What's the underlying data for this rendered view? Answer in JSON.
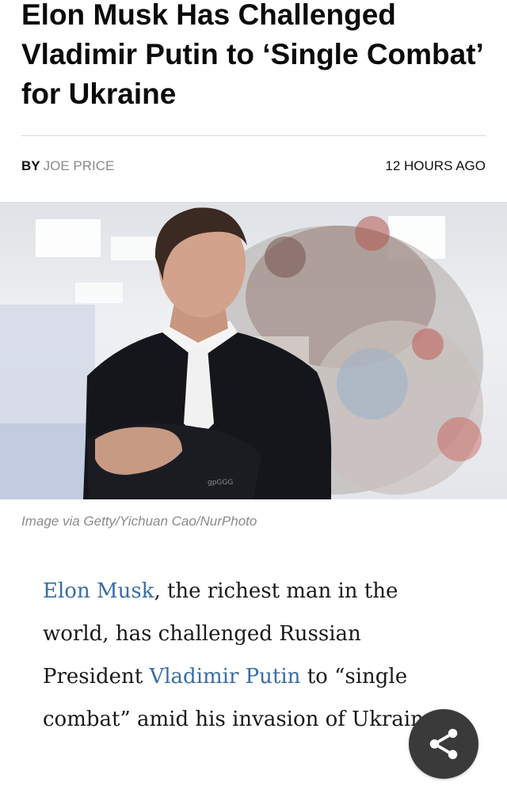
{
  "article": {
    "headline": "Elon Musk Has Challenged Vladimir Putin to ‘Single Combat’ for Ukraine",
    "byline_prefix": "BY",
    "author": "JOE PRICE",
    "timestamp": "12 HOURS AGO",
    "image_caption": "Image via Getty/Yichuan Cao/NurPhoto",
    "image_watermark": "gpGGG",
    "body": {
      "link_musk": "Elon Musk",
      "text_1": ", the richest man in the world, has challenged Russian President ",
      "link_putin": "Vladimir Putin",
      "text_2": " to “single combat” amid his invasion of Ukraine."
    }
  },
  "share_button": {
    "icon": "share-icon"
  },
  "colors": {
    "link": "#3a6ea5",
    "byline_muted": "#8a8a8a",
    "share_bg": "#3a3a3a"
  }
}
